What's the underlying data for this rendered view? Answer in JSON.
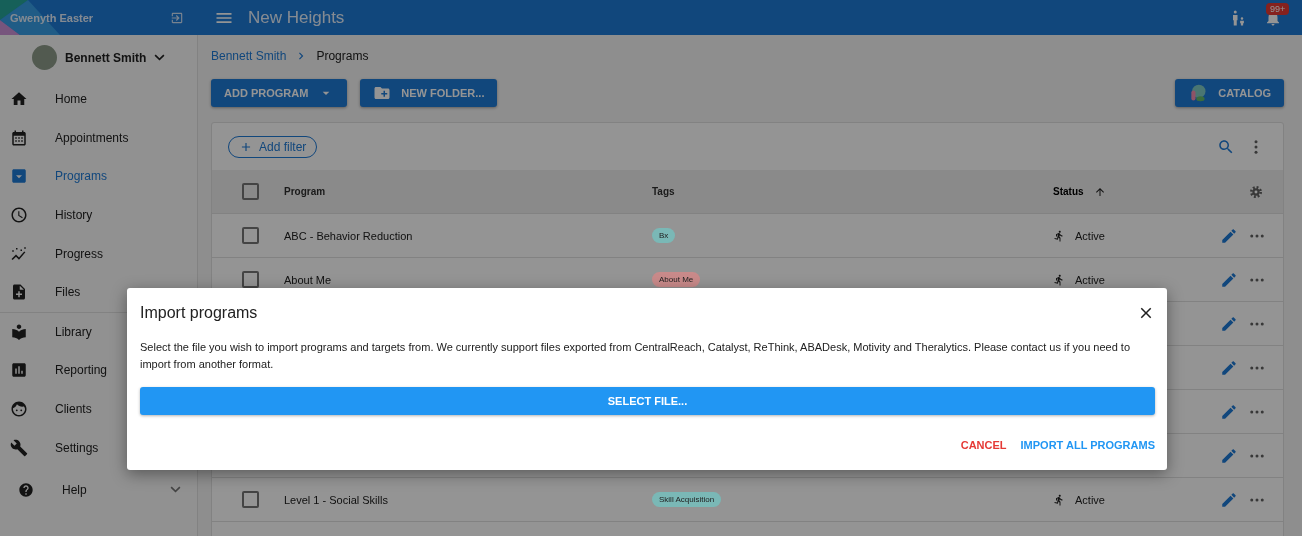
{
  "app": {
    "user_name": "Gwenyth Easter",
    "title": "New Heights",
    "notification_badge": "99+"
  },
  "sidebar": {
    "client_name": "Bennett Smith",
    "sections": [
      {
        "items": [
          {
            "label": "Home",
            "selected": false
          },
          {
            "label": "Appointments",
            "selected": false
          },
          {
            "label": "Programs",
            "selected": true
          },
          {
            "label": "History",
            "selected": false
          },
          {
            "label": "Progress",
            "selected": false
          },
          {
            "label": "Files",
            "selected": false
          }
        ]
      },
      {
        "items": [
          {
            "label": "Library",
            "selected": false
          },
          {
            "label": "Reporting",
            "selected": false
          },
          {
            "label": "Clients",
            "selected": false
          },
          {
            "label": "Settings",
            "selected": false
          }
        ]
      }
    ],
    "help": {
      "label": "Help",
      "expanded": false
    }
  },
  "breadcrumb": [
    {
      "label": "Bennett Smith",
      "kind": "link"
    },
    {
      "label": "Programs",
      "kind": "current"
    }
  ],
  "toolbar": {
    "add_program": "ADD PROGRAM",
    "new_folder": "NEW FOLDER...",
    "catalog": "CATALOG"
  },
  "filter": {
    "add_filter": "Add filter"
  },
  "table": {
    "all_checked": false,
    "columns": [
      {
        "label": "Program",
        "sorted": false
      },
      {
        "label": "Tags",
        "sorted": false
      },
      {
        "label": "Status",
        "sorted": true
      }
    ],
    "rows": [
      {
        "program": "ABC - Behavior Reduction",
        "tags": [
          {
            "label": "Bx",
            "color": "#7ab8b6"
          }
        ],
        "status": "Active",
        "checked": false
      },
      {
        "program": "About Me",
        "tags": [
          {
            "label": "About Me",
            "color": "#c98a8a"
          }
        ],
        "status": "Active",
        "checked": false
      },
      {},
      {},
      {},
      {},
      {
        "program": "Level 1 - Social Skills",
        "tags": [
          {
            "label": "Skill Acquisition",
            "color": "#7ab8b6"
          }
        ],
        "status": "Active",
        "checked": false
      }
    ]
  },
  "dialog": {
    "title": "Import programs",
    "message": "Select the file you wish to import programs and targets from. We currently support files exported from CentralReach, Catalyst, ReThink, ABADesk, Motivity and Theralytics. Please contact us if you need to import from another format.",
    "select_file": "SELECT FILE...",
    "actions": [
      {
        "label": "CANCEL",
        "kind": "cancel"
      },
      {
        "label": "IMPORT ALL PROGRAMS",
        "kind": "confirm"
      }
    ]
  }
}
